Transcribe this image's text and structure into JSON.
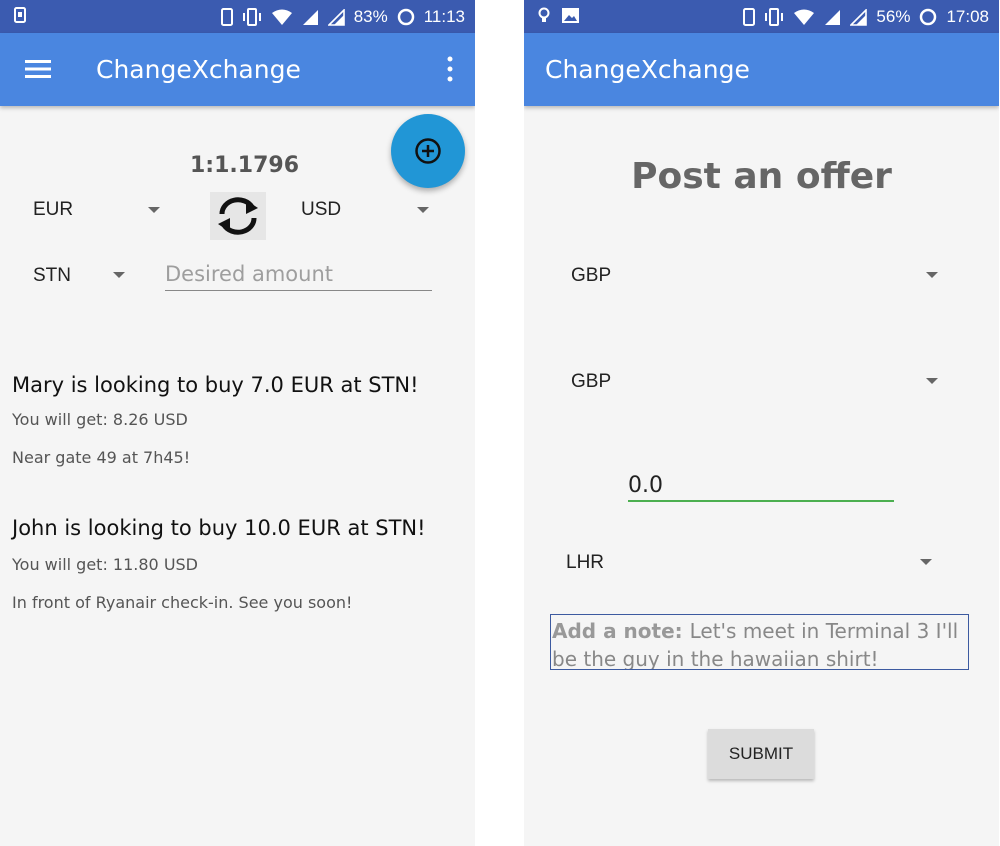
{
  "left_screen": {
    "statusbar": {
      "battery": "83%",
      "time": "11:13"
    },
    "appbar": {
      "title": "ChangeXchange"
    },
    "rate": "1:1.1796",
    "from_currency": "EUR",
    "to_currency": "USD",
    "airport": "STN",
    "amount_placeholder": "Desired amount",
    "offers": [
      {
        "title": "Mary is looking to buy 7.0 EUR at STN!",
        "you_get": "You will get: 8.26 USD",
        "note": "Near gate 49 at 7h45!"
      },
      {
        "title": "John is looking to buy 10.0 EUR at STN!",
        "you_get": "You will get: 11.80 USD",
        "note": "In front of Ryanair check-in. See you soon!"
      }
    ],
    "icons": {
      "menu": "hamburger-menu-icon",
      "more": "more-vert-icon",
      "fab": "add-circle-icon",
      "swap": "swap-refresh-icon"
    }
  },
  "right_screen": {
    "statusbar": {
      "battery": "56%",
      "time": "17:08"
    },
    "appbar": {
      "title": "ChangeXchange"
    },
    "heading": "Post an offer",
    "currency_1": "GBP",
    "currency_2": "GBP",
    "amount_value": "0.0",
    "airport": "LHR",
    "note_label": "Add a note:",
    "note_text": "Let's meet in Terminal 3 I'll be the guy in the hawaiian shirt!",
    "submit_label": "SUBMIT"
  },
  "colors": {
    "status_bar": "#3b5bb0",
    "app_bar": "#4a86e0",
    "fab": "#2196d6",
    "input_focus": "#4caf50"
  }
}
